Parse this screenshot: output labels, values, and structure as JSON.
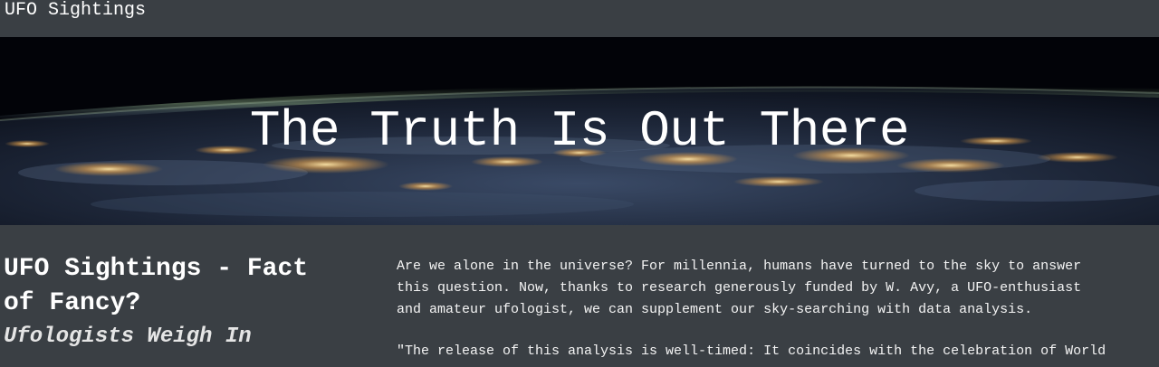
{
  "navbar": {
    "brand": "UFO Sightings"
  },
  "hero": {
    "title": "The Truth Is Out There",
    "image_icon": "earth-at-night-image"
  },
  "article": {
    "headline": "UFO Sightings - Fact\nof Fancy?",
    "subheadline": "Ufologists Weigh In",
    "paragraph1": "Are we alone in the universe? For millennia, humans have turned to the sky to answer\nthis question. Now, thanks to research generously funded by W. Avy, a UFO-enthusiast\nand amateur ufologist, we can supplement our sky-searching with data analysis.",
    "paragraph2": "\"The release of this analysis is well-timed: It coincides with the celebration of World"
  }
}
